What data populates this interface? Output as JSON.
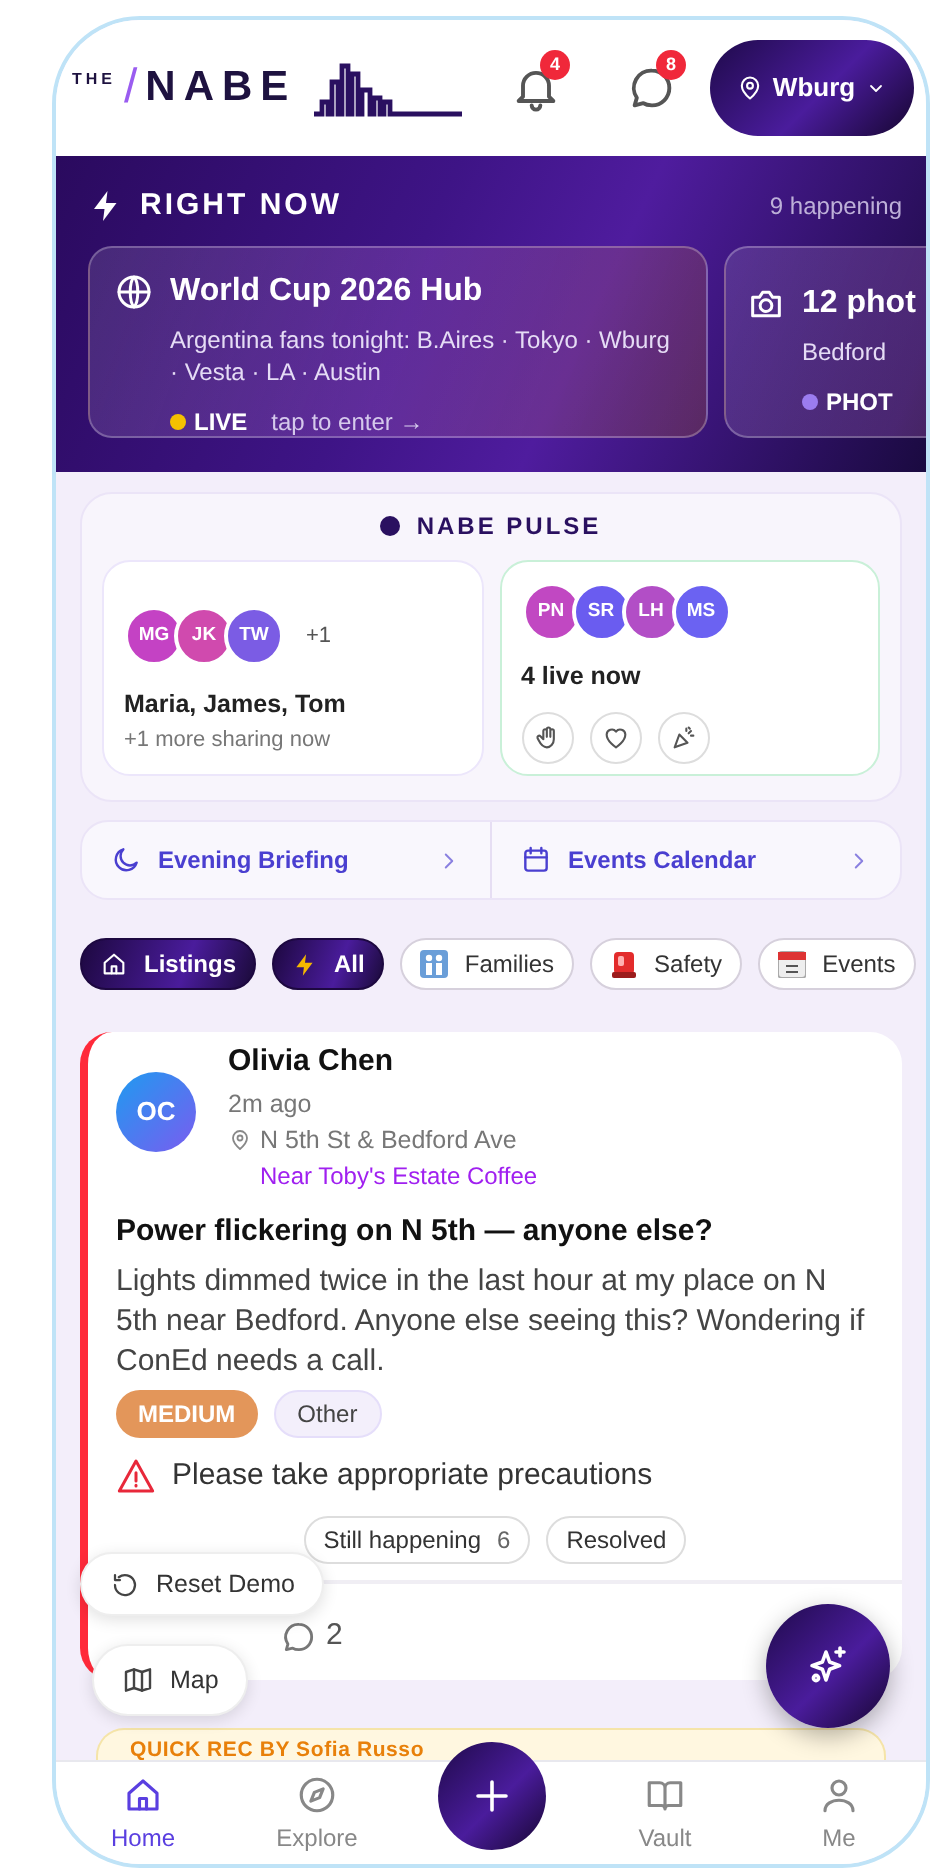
{
  "header": {
    "logo_small": "THE",
    "logo_slash": "/",
    "logo_name": "NABE",
    "notifications": "4",
    "messages": "8",
    "location": "Wburg"
  },
  "right_now": {
    "title": "RIGHT NOW",
    "count": "9 happening",
    "cards": [
      {
        "kind": "globe",
        "title": "World Cup 2026 Hub",
        "subtitle": "Argentina fans tonight: B.Aires · Tokyo · Wburg · Vesta · LA · Austin",
        "status": "LIVE",
        "color": "#f5c000",
        "action": "tap to enter →"
      },
      {
        "kind": "camera",
        "title": "12 phot",
        "subtitle": "Bedford",
        "status": "PHOT",
        "color": "#9b7cf0"
      }
    ]
  },
  "pulse": {
    "title": "NABE PULSE",
    "cards": [
      {
        "live": false,
        "avatars": [
          {
            "initials": "MG",
            "color": "#c442c4"
          },
          {
            "initials": "JK",
            "color": "#d04aae"
          },
          {
            "initials": "TW",
            "color": "#7b5ce4"
          }
        ],
        "more": "+1",
        "title": "Maria, James, Tom",
        "subtitle": "+1 more sharing now"
      },
      {
        "live": true,
        "avatars": [
          {
            "initials": "PN",
            "color": "#c148c2"
          },
          {
            "initials": "SR",
            "color": "#6a5cf0"
          },
          {
            "initials": "LH",
            "color": "#b24ec6"
          },
          {
            "initials": "MS",
            "color": "#6b62f2"
          }
        ],
        "title": "4 live now",
        "reactions": [
          {
            "kind": "hand"
          },
          {
            "kind": "heart"
          },
          {
            "kind": "party"
          }
        ]
      }
    ]
  },
  "shortcuts": [
    {
      "kind": "moon",
      "label": "Evening Briefing"
    },
    {
      "kind": "calendar",
      "label": "Events Calendar"
    }
  ],
  "filters": [
    {
      "kind": "home",
      "label": "Listings",
      "selected": true
    },
    {
      "kind": "bolt",
      "label": "All",
      "selected": true
    },
    {
      "kind": "families",
      "label": "Families",
      "selected": false
    },
    {
      "kind": "siren",
      "label": "Safety",
      "selected": false
    },
    {
      "kind": "calendar",
      "label": "Events",
      "selected": false
    }
  ],
  "post": {
    "author": "Olivia Chen",
    "initials": "OC",
    "time": "2m ago",
    "location": "N 5th St & Bedford Ave",
    "landmark": "Near Toby's Estate Coffee",
    "title": "Power flickering on N 5th — anyone else?",
    "body": "Lights dimmed twice in the last hour at my place on N 5th near Bedford. Anyone else seeing this? Wondering if ConEd needs a call.",
    "severity": "MEDIUM",
    "category": "Other",
    "warning": "Please take appropriate precautions",
    "responses": [
      {
        "label": "Still happening",
        "count": "6"
      },
      {
        "label": "Resolved"
      }
    ],
    "comments": "2"
  },
  "next_post": {
    "label": "QUICK REC BY Sofia Russo"
  },
  "floating": {
    "reset": "Reset Demo",
    "map": "Map"
  },
  "nav": [
    {
      "kind": "home",
      "label": "Home",
      "selected": true
    },
    {
      "kind": "compass",
      "label": "Explore",
      "selected": false
    },
    {
      "kind": "plus"
    },
    {
      "kind": "book",
      "label": "Vault",
      "selected": false
    },
    {
      "kind": "person",
      "label": "Me",
      "selected": false
    }
  ]
}
